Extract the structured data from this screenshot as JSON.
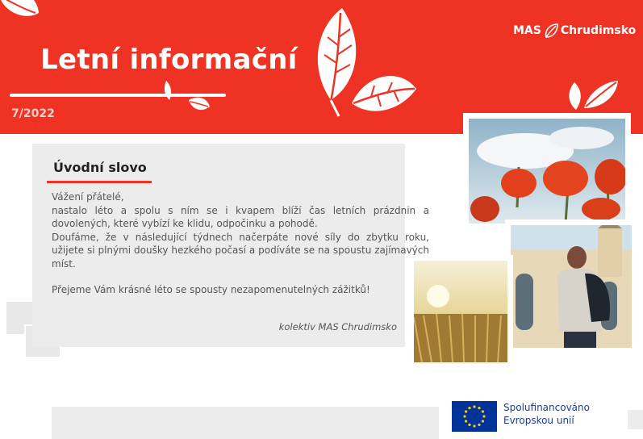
{
  "header": {
    "title": "Letní informační",
    "issue": "7/2022",
    "logo_prefix": "MAS",
    "logo_name": "Chrudimsko"
  },
  "intro": {
    "title": "Úvodní slovo",
    "lines": [
      "Vážení přátelé,",
      "nastalo léto a spolu s ním se i kvapem blíží čas letních prázdnin a dovolených, které vybízí ke klidu, odpočinku a pohodě.",
      "Doufáme, že v následující týdnech načerpáte nové síly do zbytku roku, užijete si plnými doušky hezkého počasí a podíváte se na spoustu zajímavých míst."
    ],
    "wish": "Přejeme Vám krásné léto se spousty nezapomenutelných zážitků!",
    "signature": "kolektiv MAS Chrudimsko"
  },
  "footer": {
    "eu_line1": "Spolufinancováno",
    "eu_line2": "Evropskou unií"
  },
  "colors": {
    "brand_red": "#ee3223",
    "panel_gray": "#ececec",
    "eu_blue": "#003399"
  },
  "icons": [
    "leaf-icon",
    "mas-logo-leaf-icon",
    "eu-flag-icon"
  ]
}
